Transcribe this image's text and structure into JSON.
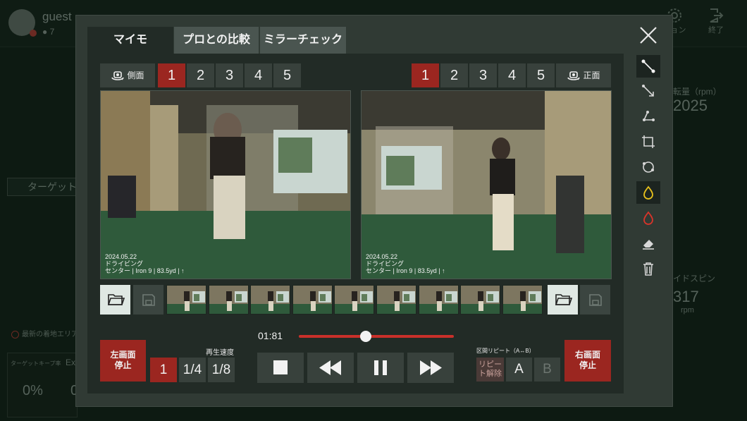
{
  "background": {
    "user_name": "guest",
    "user_count": "● 7",
    "top_icons": [
      {
        "icon": "gear-icon",
        "label": "ション"
      },
      {
        "icon": "exit-icon",
        "label": "終了"
      }
    ],
    "target_label": "ターゲット",
    "spin_label": "転量（rpm）",
    "spin_value": "2025",
    "side_spin_label": "イドスピン",
    "side_spin_value": "317",
    "side_spin_unit": "rpm",
    "area_label": "最新の着地エリア",
    "target_rate_label": "ターゲットキープ率",
    "target_rate_ex": "Ex",
    "percent_value": "0%",
    "percent_value_2": "0"
  },
  "modal": {
    "tabs": [
      {
        "label": "マイモ",
        "active": true
      },
      {
        "label": "プロとの比較",
        "active": false
      },
      {
        "label": "ミラーチェック",
        "active": false
      }
    ],
    "left_camera_label": "側面",
    "right_camera_label": "正面",
    "left_numbers": [
      "1",
      "2",
      "3",
      "4",
      "5"
    ],
    "right_numbers": [
      "1",
      "2",
      "3",
      "4",
      "5"
    ],
    "left_video": {
      "date": "2024.05.22",
      "mode": "ドライビング",
      "shot": "センター | Iron 9 | 83.5yd | ↑"
    },
    "right_video": {
      "date": "2024.05.22",
      "mode": "ドライビング",
      "shot": "センター | Iron 9 | 83.5yd | ↑"
    },
    "thumbnail_count": 9,
    "time": "01:81",
    "progress": 0.43,
    "left_stop_label": "左画面\n停止",
    "right_stop_label": "右画面\n停止",
    "speed_label": "再生速度",
    "speeds": [
      "1",
      "1/4",
      "1/8"
    ],
    "repeat_label": "区間リピート（A↔B）",
    "repeat_release_label": "リピー\nト解除",
    "a_label": "A",
    "b_label": "B",
    "side_tools": [
      "line-icon",
      "arrow-line-icon",
      "angle-icon",
      "rectangle-icon",
      "circle-icon",
      "yellow-drop-icon",
      "red-drop-icon",
      "eraser-icon",
      "trash-icon"
    ],
    "colors": {
      "accent_red": "#9b2620",
      "modal_bg": "#303a34",
      "inner_bg": "#222b26",
      "button_bg": "#38413c",
      "slider_red": "#c9302a"
    }
  }
}
